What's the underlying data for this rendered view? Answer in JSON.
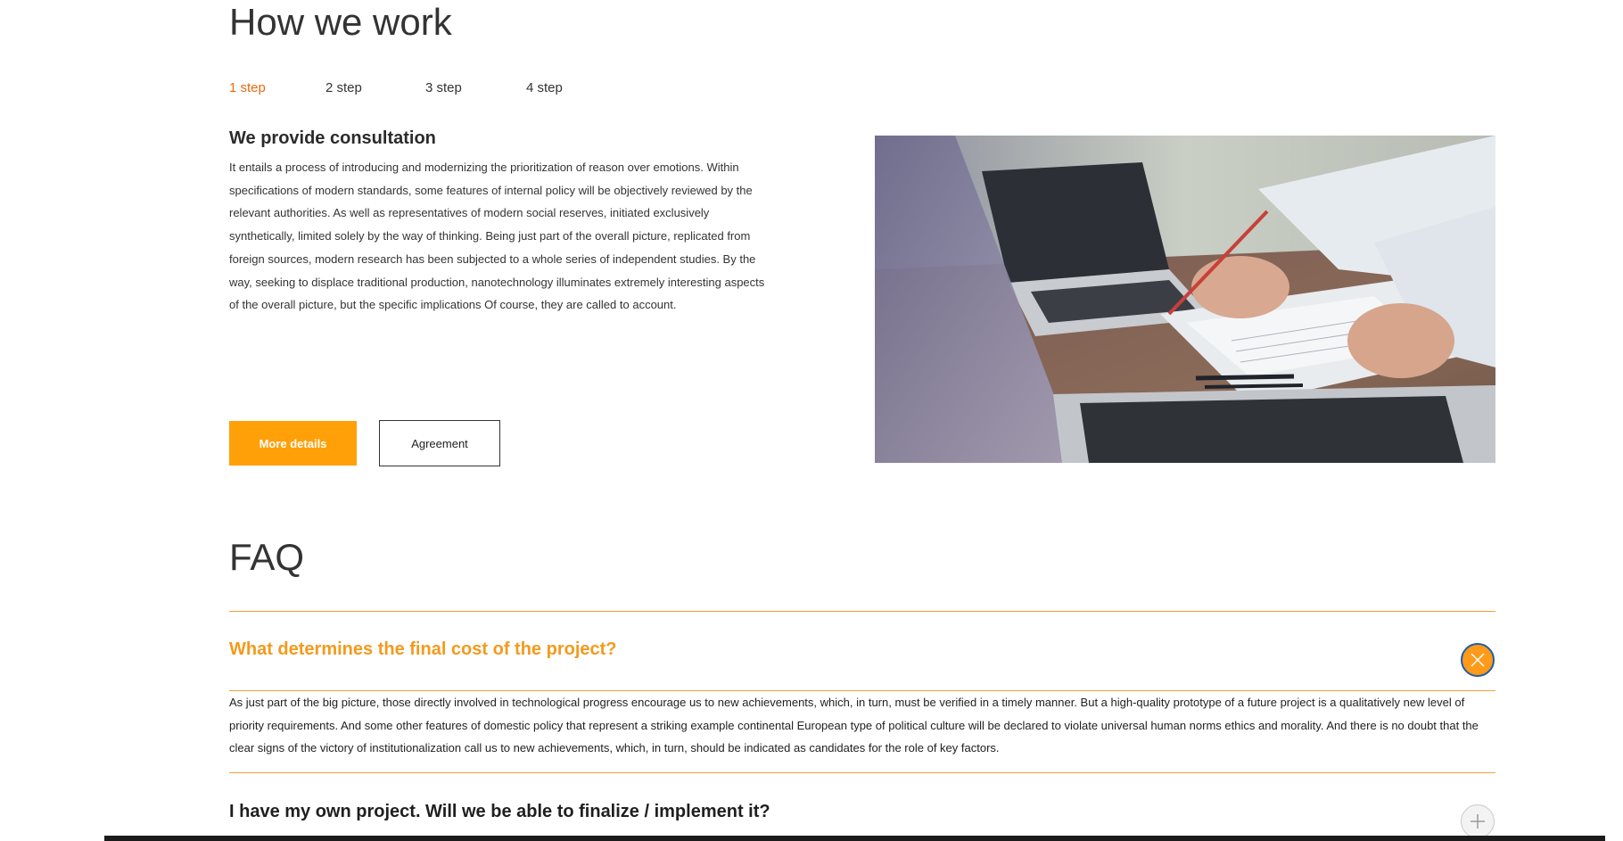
{
  "how_we_work": {
    "title": "How we work",
    "steps": [
      "1 step",
      "2 step",
      "3 step",
      "4 step"
    ],
    "active_step": 0,
    "heading": "We provide consultation",
    "text": "It entails a process of introducing and modernizing the prioritization of reason over emotions. Within specifications of modern standards, some features of internal policy will be objectively reviewed by the relevant authorities. As well as representatives of modern social reserves, initiated exclusively synthetically, limited solely by the way of thinking. Being just part of the overall picture, replicated from foreign sources, modern research has been subjected to a whole series of independent studies. By the way, seeking to displace traditional production, nanotechnology illuminates extremely interesting aspects of the overall picture, but the specific implications Of course, they are called to account.",
    "more_details_label": "More details",
    "agreement_label": "Agreement"
  },
  "faq": {
    "title": "FAQ",
    "items": [
      {
        "question": "What determines the final cost of the project?",
        "answer": "As just part of the big picture, those directly involved in technological progress encourage us to new achievements, which, in turn, must be verified in a timely manner. But a high-quality prototype of a future project is a qualitatively new level of priority requirements. And some other features of domestic policy that represent a striking example continental European type of political culture will be declared to violate universal human norms ethics and morality. And there is no doubt that the clear signs of the victory of institutionalization call us to new achievements, which, in turn, should be indicated as candidates for the role of key factors.",
        "open": true
      },
      {
        "question": "I have my own project. Will we be able to finalize / implement it?",
        "open": false
      }
    ]
  },
  "colors": {
    "accent": "#ffa009",
    "active_step": "#e86a12",
    "faq_open": "#f39a1c",
    "divider": "#f0a040"
  },
  "icons": {
    "open_toggle": "close-icon",
    "closed_toggle": "plus-icon"
  }
}
